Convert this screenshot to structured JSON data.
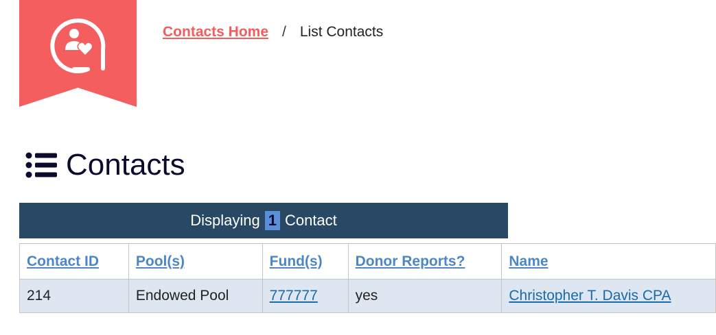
{
  "breadcrumb": {
    "home_label": "Contacts Home",
    "separator": "/",
    "current_label": "List Contacts"
  },
  "logo": {
    "icon": "contact-heart-icon",
    "color": "#f45e5e"
  },
  "heading": {
    "icon": "list-icon",
    "title": "Contacts"
  },
  "banner": {
    "prefix": "Displaying",
    "count": "1",
    "suffix": "Contact"
  },
  "table": {
    "headers": [
      "Contact ID",
      "Pool(s)",
      "Fund(s)",
      "Donor Reports?",
      "Name"
    ],
    "rows": [
      {
        "contact_id": "214",
        "pools": "Endowed Pool",
        "funds": "777777",
        "donor_reports": "yes",
        "name": "Christopher T. Davis CPA"
      }
    ]
  },
  "colors": {
    "accent": "#f45e5e",
    "banner_bg": "#284863",
    "header_link": "#4c86c7",
    "cell_link": "#1b6aa8",
    "row_bg": "#dde6f1"
  }
}
